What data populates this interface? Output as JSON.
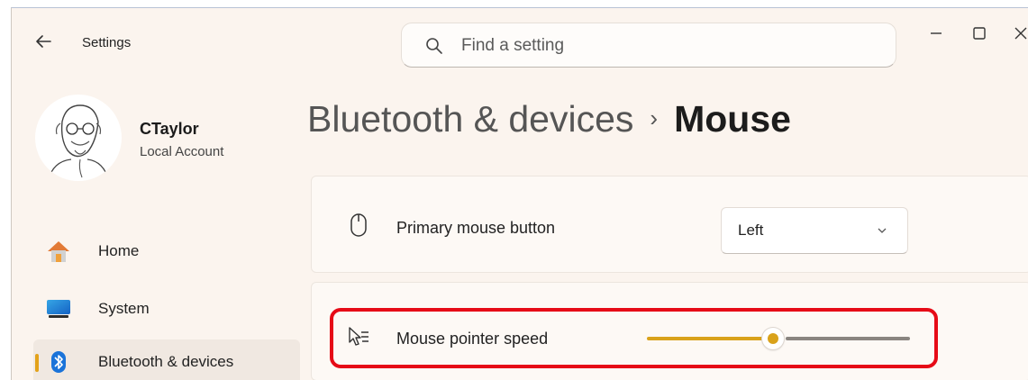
{
  "window": {
    "title": "Settings"
  },
  "search": {
    "placeholder": "Find a setting"
  },
  "user": {
    "name": "CTaylor",
    "account_type": "Local Account"
  },
  "nav": {
    "items": [
      {
        "label": "Home",
        "icon": "home-icon"
      },
      {
        "label": "System",
        "icon": "system-icon"
      },
      {
        "label": "Bluetooth & devices",
        "icon": "bluetooth-icon",
        "selected": true
      }
    ]
  },
  "header": {
    "parent": "Bluetooth & devices",
    "separator": "›",
    "current": "Mouse"
  },
  "settings": {
    "primary_button": {
      "label": "Primary mouse button",
      "value": "Left",
      "icon": "mouse-icon"
    },
    "pointer_speed": {
      "label": "Mouse pointer speed",
      "value_fraction": 0.48,
      "icon": "pointer-speed-icon"
    }
  },
  "colors": {
    "accent": "#d9a21b",
    "highlight": "#e60b17",
    "background": "#fbf4ee",
    "card": "#fdf9f5"
  }
}
